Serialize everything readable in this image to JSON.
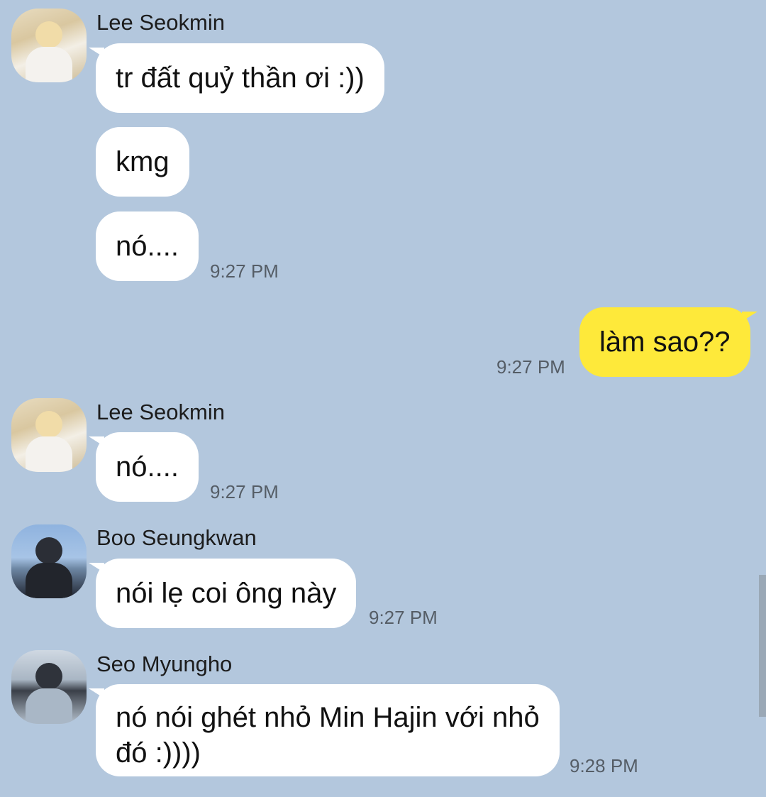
{
  "messages": [
    {
      "sender": "Lee Seokmin",
      "bubbles": [
        "tr đất quỷ thần ơi :))",
        "kmg",
        "nó...."
      ],
      "time": "9:27 PM"
    },
    {
      "sender": "me",
      "bubbles": [
        "làm sao??"
      ],
      "time": "9:27 PM"
    },
    {
      "sender": "Lee Seokmin",
      "bubbles": [
        "nó...."
      ],
      "time": "9:27 PM"
    },
    {
      "sender": "Boo Seungkwan",
      "bubbles": [
        "nói lẹ coi ông này"
      ],
      "time": "9:27 PM"
    },
    {
      "sender": "Seo Myungho",
      "bubbles": [
        "nó nói ghét nhỏ Min Hajin với nhỏ đó :))))"
      ],
      "time": "9:28 PM"
    }
  ],
  "colors": {
    "background": "#b3c7dd",
    "incoming_bubble": "#ffffff",
    "outgoing_bubble": "#fee93a"
  },
  "icons": [
    "avatar-lee-seokmin",
    "avatar-boo-seungkwan",
    "avatar-seo-myungho"
  ]
}
